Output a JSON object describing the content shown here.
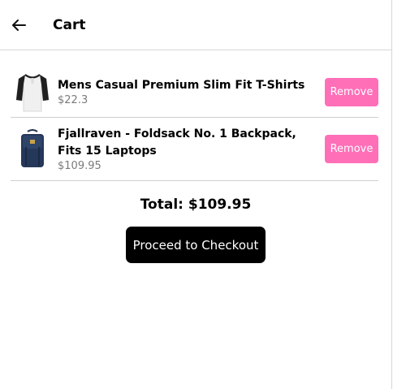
{
  "header": {
    "title": "Cart",
    "back_icon": "arrow-left-icon"
  },
  "cart": {
    "items": [
      {
        "title": "Mens Casual Premium Slim Fit T-Shirts",
        "price": "$22.3",
        "remove_label": "Remove",
        "image_icon": "tshirt-image"
      },
      {
        "title": "Fjallraven - Foldsack No. 1 Backpack, Fits 15 Laptops",
        "price": "$109.95",
        "remove_label": "Remove",
        "image_icon": "backpack-image"
      }
    ],
    "total_label": "Total: $109.95",
    "checkout_label": "Proceed to Checkout"
  },
  "colors": {
    "remove_button": "#ff6fb8",
    "checkout_button": "#000000",
    "price_text": "#7a7a7a"
  }
}
